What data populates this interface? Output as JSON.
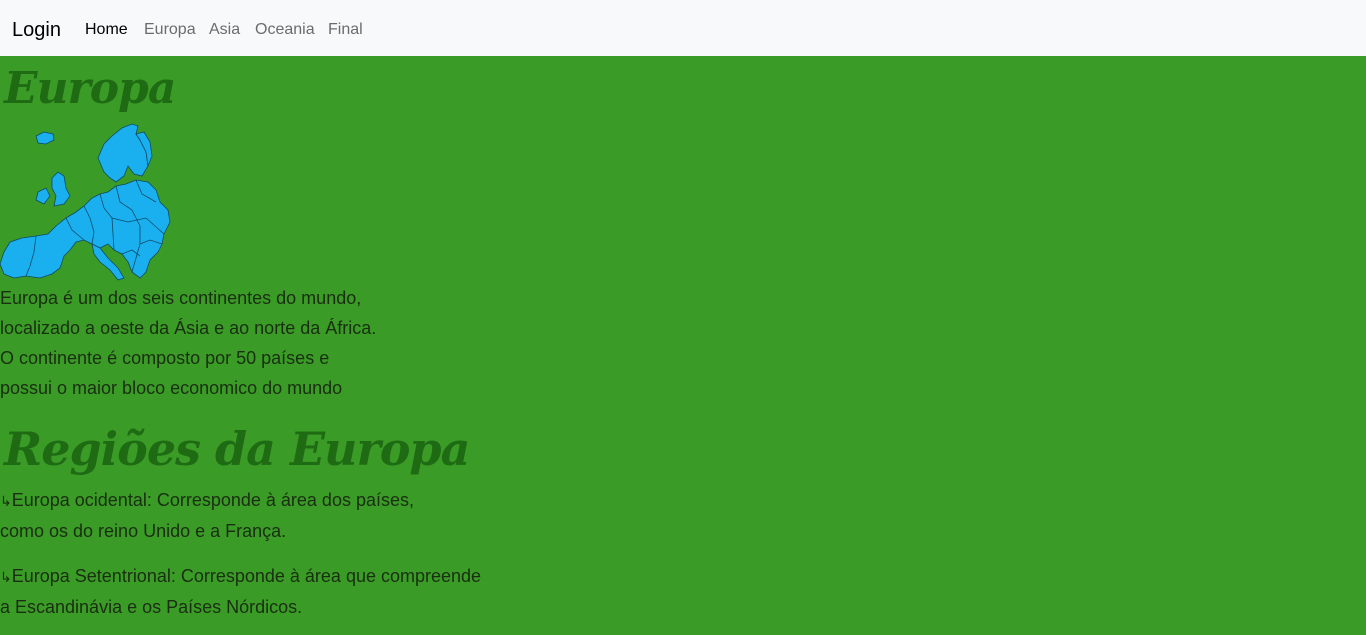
{
  "navbar": {
    "brand": "Login",
    "links": [
      "Home",
      "Europa",
      "Asia",
      "Oceania",
      "Final"
    ]
  },
  "main": {
    "title": "Europa",
    "intro": [
      "Europa é um dos seis continentes do mundo,",
      "localizado a oeste da Ásia e ao norte da África.",
      "O continente é composto por 50 países e",
      "possui o maior bloco economico do mundo"
    ],
    "regions_title": "Regiões da Europa",
    "regions": [
      {
        "arrow": "↳",
        "line1": "Europa ocidental: Corresponde à área dos países,",
        "line2": "como os do reino Unido e a França."
      },
      {
        "arrow": "↳",
        "line1": "Europa Setentrional: Corresponde à área que compreende",
        "line2": "a Escandinávia e os Países Nórdicos."
      }
    ]
  },
  "colors": {
    "background": "#3a9c26",
    "heading": "#1f6b14",
    "map_fill": "#1ab0f0"
  },
  "icons": {
    "map": "europe-map-icon",
    "arrow": "return-arrow-icon"
  }
}
